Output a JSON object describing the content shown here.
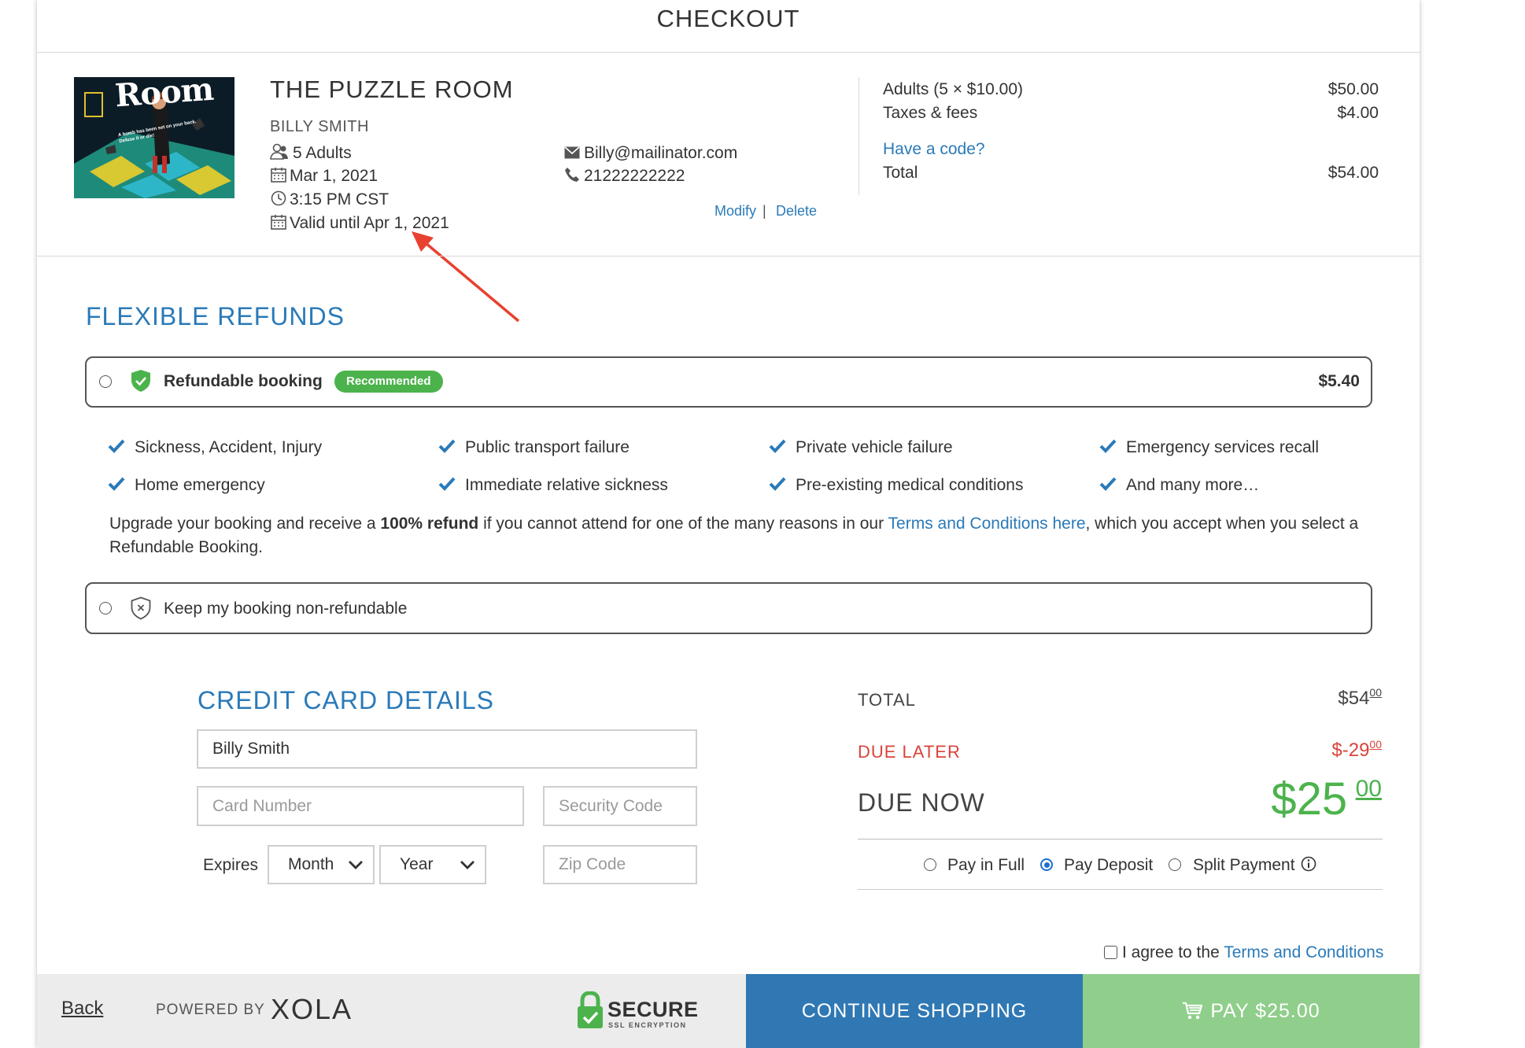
{
  "header": {
    "title": "CHECKOUT"
  },
  "booking": {
    "experience_title": "THE PUZZLE ROOM",
    "customer_name": "BILLY SMITH",
    "guests": "5 Adults",
    "date": "Mar 1, 2021",
    "time": "3:15 PM CST",
    "valid_until": "Valid until Apr 1, 2021",
    "email": "Billy@mailinator.com",
    "phone": "21222222222",
    "modify_label": "Modify",
    "separator": "|",
    "delete_label": "Delete",
    "image_title": "Room",
    "image_tagline": "A bomb has been set on your back. Defuse it or die!"
  },
  "summary": {
    "line1_label": "Adults (5 × $10.00)",
    "line1_value": "$50.00",
    "line2_label": "Taxes & fees",
    "line2_value": "$4.00",
    "code_link": "Have a code?",
    "total_label": "Total",
    "total_value": "$54.00"
  },
  "refunds": {
    "title": "FLEXIBLE REFUNDS",
    "refundable_label": "Refundable booking",
    "recommended_badge": "Recommended",
    "refundable_price": "$5.40",
    "features": [
      "Sickness, Accident, Injury",
      "Public transport failure",
      "Private vehicle failure",
      "Emergency services recall",
      "Home emergency",
      "Immediate relative sickness",
      "Pre-existing medical conditions",
      "And many more…"
    ],
    "desc_part1": "Upgrade your booking and receive a ",
    "desc_bold": "100% refund",
    "desc_part2": " if you cannot attend for one of the many reasons in our ",
    "desc_link": "Terms and Conditions here",
    "desc_part3": ", which you accept when you select a",
    "desc_line2": "Refundable Booking.",
    "nonrefundable_label": "Keep my booking non-refundable"
  },
  "card": {
    "title": "CREDIT CARD DETAILS",
    "name_value": "Billy Smith",
    "card_number_placeholder": "Card Number",
    "security_code_placeholder": "Security Code",
    "expires_label": "Expires",
    "month_value": "Month",
    "year_value": "Year",
    "zip_placeholder": "Zip Code"
  },
  "totals": {
    "total_label": "TOTAL",
    "total_main": "$54",
    "total_cents": "00",
    "due_later_label": "DUE LATER",
    "due_later_main": "$-29",
    "due_later_cents": "00",
    "due_now_label": "DUE NOW",
    "due_now_main": "$25",
    "due_now_cents": "00",
    "pay_full_label": "Pay in Full",
    "pay_deposit_label": "Pay Deposit",
    "split_payment_label": "Split Payment",
    "selected_option": "Pay Deposit"
  },
  "agree": {
    "prefix": "I agree to the ",
    "link": "Terms and Conditions"
  },
  "footer": {
    "back_label": "Back",
    "powered_by": "POWERED BY",
    "brand": "XOLA",
    "secure_title": "SECURE",
    "secure_sub": "SSL ENCRYPTION",
    "continue_label": "CONTINUE SHOPPING",
    "pay_label": "PAY $25.00"
  },
  "colors": {
    "accent_blue": "#2a7ab8",
    "green": "#4cb34c",
    "red": "#d9443a",
    "continue_bg": "#2f78b4",
    "pay_bg": "#8fce8b",
    "footer_bg": "#ececec"
  }
}
